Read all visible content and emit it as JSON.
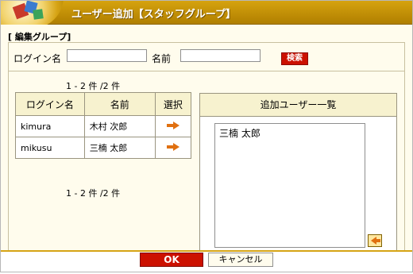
{
  "window": {
    "title": "ユーザー追加【スタッフグループ】"
  },
  "group": {
    "label": "[ 編集グループ]"
  },
  "search": {
    "login_label": "ログイン名",
    "login_value": "",
    "name_label": "名前",
    "name_value": "",
    "button_label": "検索"
  },
  "list": {
    "count_text": "1 - 2 件 /2 件",
    "columns": [
      "ログイン名",
      "名前",
      "選択"
    ],
    "rows": [
      {
        "login": "kimura",
        "name": "木村 次郎"
      },
      {
        "login": "mikusu",
        "name": "三楠 太郎"
      }
    ]
  },
  "panel": {
    "title": "追加ユーザー一覧",
    "items": [
      "三楠 太郎"
    ]
  },
  "footer": {
    "ok_label": "OK",
    "cancel_label": "キャンセル"
  },
  "colors": {
    "title_bar": "#c99200",
    "accent_red": "#cc1100",
    "panel_bg": "#fffced",
    "header_bg": "#f7f2cf",
    "arrow": "#e07010"
  },
  "icons": {
    "select_arrow": "arrow-right-icon",
    "remove_arrow": "arrow-left-icon"
  }
}
